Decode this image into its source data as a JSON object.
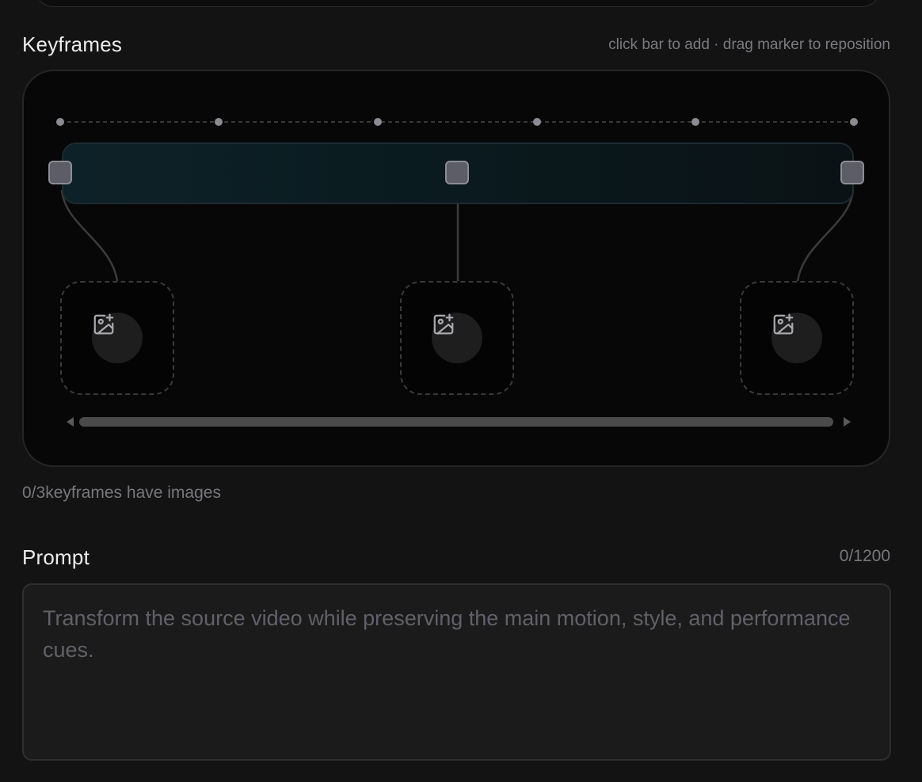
{
  "keyframes": {
    "title": "Keyframes",
    "hint": "click bar to add · drag marker to reposition",
    "count_prefix": "0/3",
    "count_suffix": "keyframes have images",
    "images_attached": 0,
    "total_keyframes": 3,
    "tick_count": 6,
    "marker_positions": [
      0,
      0.5,
      1.0
    ],
    "accent_color": "#0d2228",
    "marker_color": "#5d5d68",
    "slot_icon": "image-add-icon"
  },
  "prompt": {
    "title": "Prompt",
    "char_count": "0/1200",
    "value": "",
    "placeholder": "Transform the source video while preserving the main motion, style, and performance cues."
  }
}
